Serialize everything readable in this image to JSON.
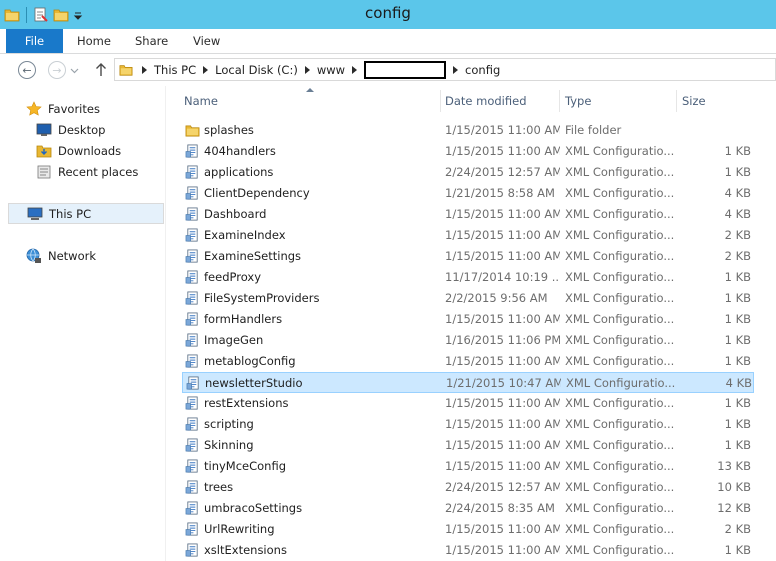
{
  "window": {
    "title": "config"
  },
  "ribbon": {
    "tabs": [
      "File",
      "Home",
      "Share",
      "View"
    ]
  },
  "address": {
    "crumbs": [
      "This PC",
      "Local Disk (C:)",
      "www",
      "",
      "config"
    ]
  },
  "nav": {
    "favorites_label": "Favorites",
    "favorites": [
      "Desktop",
      "Downloads",
      "Recent places"
    ],
    "this_pc": "This PC",
    "network": "Network"
  },
  "columns": {
    "name": "Name",
    "date": "Date modified",
    "type": "Type",
    "size": "Size"
  },
  "files": [
    {
      "name": "splashes",
      "date": "1/15/2015 11:00 AM",
      "type": "File folder",
      "size": "",
      "icon": "folder-icon"
    },
    {
      "name": "404handlers",
      "date": "1/15/2015 11:00 AM",
      "type": "XML Configuratio...",
      "size": "1 KB",
      "icon": "xml-config-file-icon"
    },
    {
      "name": "applications",
      "date": "2/24/2015 12:57 AM",
      "type": "XML Configuratio...",
      "size": "1 KB",
      "icon": "xml-config-file-icon"
    },
    {
      "name": "ClientDependency",
      "date": "1/21/2015 8:58 AM",
      "type": "XML Configuratio...",
      "size": "4 KB",
      "icon": "xml-config-file-icon"
    },
    {
      "name": "Dashboard",
      "date": "1/15/2015 11:00 AM",
      "type": "XML Configuratio...",
      "size": "4 KB",
      "icon": "xml-config-file-icon"
    },
    {
      "name": "ExamineIndex",
      "date": "1/15/2015 11:00 AM",
      "type": "XML Configuratio...",
      "size": "2 KB",
      "icon": "xml-config-file-icon"
    },
    {
      "name": "ExamineSettings",
      "date": "1/15/2015 11:00 AM",
      "type": "XML Configuratio...",
      "size": "2 KB",
      "icon": "xml-config-file-icon"
    },
    {
      "name": "feedProxy",
      "date": "11/17/2014 10:19 ...",
      "type": "XML Configuratio...",
      "size": "1 KB",
      "icon": "xml-config-file-icon"
    },
    {
      "name": "FileSystemProviders",
      "date": "2/2/2015 9:56 AM",
      "type": "XML Configuratio...",
      "size": "1 KB",
      "icon": "xml-config-file-icon"
    },
    {
      "name": "formHandlers",
      "date": "1/15/2015 11:00 AM",
      "type": "XML Configuratio...",
      "size": "1 KB",
      "icon": "xml-config-file-icon"
    },
    {
      "name": "ImageGen",
      "date": "1/16/2015 11:06 PM",
      "type": "XML Configuratio...",
      "size": "1 KB",
      "icon": "xml-config-file-icon"
    },
    {
      "name": "metablogConfig",
      "date": "1/15/2015 11:00 AM",
      "type": "XML Configuratio...",
      "size": "1 KB",
      "icon": "xml-config-file-icon"
    },
    {
      "name": "newsletterStudio",
      "date": "1/21/2015 10:47 AM",
      "type": "XML Configuratio...",
      "size": "4 KB",
      "icon": "xml-config-file-icon",
      "selected": true
    },
    {
      "name": "restExtensions",
      "date": "1/15/2015 11:00 AM",
      "type": "XML Configuratio...",
      "size": "1 KB",
      "icon": "xml-config-file-icon"
    },
    {
      "name": "scripting",
      "date": "1/15/2015 11:00 AM",
      "type": "XML Configuratio...",
      "size": "1 KB",
      "icon": "xml-config-file-icon"
    },
    {
      "name": "Skinning",
      "date": "1/15/2015 11:00 AM",
      "type": "XML Configuratio...",
      "size": "1 KB",
      "icon": "xml-config-file-icon"
    },
    {
      "name": "tinyMceConfig",
      "date": "1/15/2015 11:00 AM",
      "type": "XML Configuratio...",
      "size": "13 KB",
      "icon": "xml-config-file-icon"
    },
    {
      "name": "trees",
      "date": "2/24/2015 12:57 AM",
      "type": "XML Configuratio...",
      "size": "10 KB",
      "icon": "xml-config-file-icon"
    },
    {
      "name": "umbracoSettings",
      "date": "2/24/2015 8:35 AM",
      "type": "XML Configuratio...",
      "size": "12 KB",
      "icon": "xml-config-file-icon"
    },
    {
      "name": "UrlRewriting",
      "date": "1/15/2015 11:00 AM",
      "type": "XML Configuratio...",
      "size": "2 KB",
      "icon": "xml-config-file-icon"
    },
    {
      "name": "xsltExtensions",
      "date": "1/15/2015 11:00 AM",
      "type": "XML Configuratio...",
      "size": "1 KB",
      "icon": "xml-config-file-icon"
    }
  ]
}
